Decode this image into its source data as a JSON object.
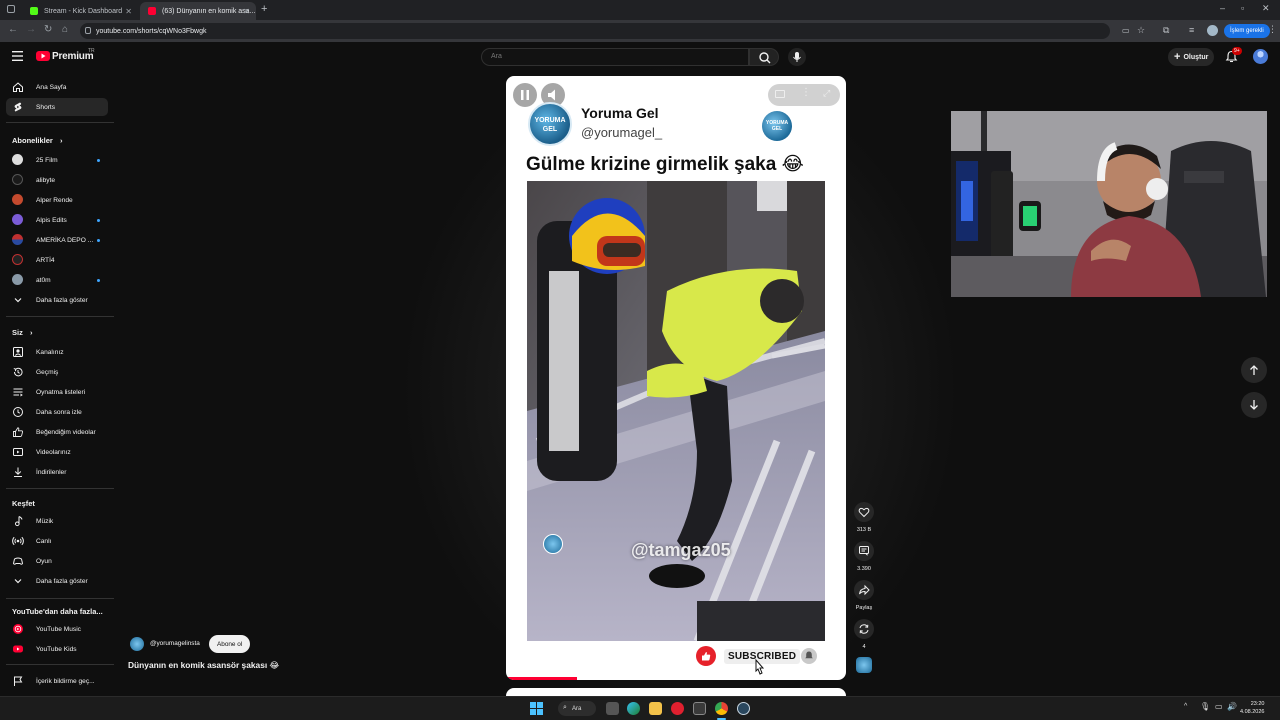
{
  "browser": {
    "tabs": [
      {
        "title": "Stream - Kick Dashboard",
        "icon": "kick-icon",
        "color": "#53fc18"
      },
      {
        "title": "(63) Dünyanın en komik asa...",
        "icon": "youtube-icon",
        "color": "#ff0033"
      }
    ],
    "new_tab": "+",
    "url": "youtube.com/shorts/cqWNo3Fbwgk",
    "profile_label": "İşlem gerekli",
    "window_controls": [
      "–",
      "▫",
      "✕"
    ]
  },
  "youtube": {
    "logo": "Premium",
    "logo_sup": "TR",
    "search_placeholder": "Ara",
    "create_label": "Oluştur",
    "notifications_badge": "9+"
  },
  "sidebar": {
    "main": [
      {
        "label": "Ana Sayfa",
        "icon": "home-icon"
      },
      {
        "label": "Shorts",
        "icon": "shorts-icon",
        "active": true
      }
    ],
    "subscriptions_title": "Abonelikler",
    "subscriptions": [
      {
        "label": "25 Film",
        "color": "#dddddd",
        "dot": true
      },
      {
        "label": "alibyte",
        "color": "#1a1a1a",
        "dot": false
      },
      {
        "label": "Alper Rende",
        "color": "#c44a2e",
        "dot": false
      },
      {
        "label": "Alpis Edits",
        "color": "#7b5cd6",
        "dot": true
      },
      {
        "label": "AMERİKA DEPO ...",
        "color": "#c03030",
        "dot": true
      },
      {
        "label": "ARTİ4",
        "color": "#222222",
        "dot": false
      },
      {
        "label": "at0m",
        "color": "#8a9aa8",
        "dot": true
      }
    ],
    "show_more": "Daha fazla göster",
    "you_title": "Siz",
    "you": [
      {
        "label": "Kanalınız",
        "icon": "account-box-icon"
      },
      {
        "label": "Geçmiş",
        "icon": "history-icon"
      },
      {
        "label": "Oynatma listeleri",
        "icon": "playlist-icon"
      },
      {
        "label": "Daha sonra izle",
        "icon": "clock-icon"
      },
      {
        "label": "Beğendiğim videolar",
        "icon": "thumbs-up-icon"
      },
      {
        "label": "Videolarınız",
        "icon": "video-icon"
      },
      {
        "label": "İndirilenler",
        "icon": "download-icon"
      }
    ],
    "explore_title": "Keşfet",
    "explore": [
      {
        "label": "Müzik",
        "icon": "music-note-icon"
      },
      {
        "label": "Canlı",
        "icon": "live-icon"
      },
      {
        "label": "Oyun",
        "icon": "gaming-icon"
      }
    ],
    "explore_more": "Daha fazla göster",
    "more_title": "YouTube'dan daha fazla...",
    "more": [
      {
        "label": "YouTube Music",
        "icon": "youtube-music-icon"
      },
      {
        "label": "YouTube Kids",
        "icon": "youtube-kids-icon"
      }
    ],
    "report": "İçerik bildirme geç..."
  },
  "short": {
    "card_channel": "Yoruma Gel",
    "card_handle": "@yorumagel_",
    "card_logo_text": "YORUMA GEL",
    "caption": "Gülme krizine girmelik şaka 😂",
    "watermark": "@tamgaz05",
    "subscribed_label": "SUBSCRIBED",
    "progress": 0.21,
    "channel_handle": "@yorumagelinsta",
    "subscribe_label": "Abone ol",
    "title": "Dünyanın en komik asansör şakası 😂"
  },
  "actions": {
    "likes": "313 B",
    "comments": "3.390",
    "share": "Paylaş",
    "remix": "4"
  },
  "taskbar": {
    "search": "Ara",
    "time": "23:20",
    "date": "4.08.2026"
  }
}
